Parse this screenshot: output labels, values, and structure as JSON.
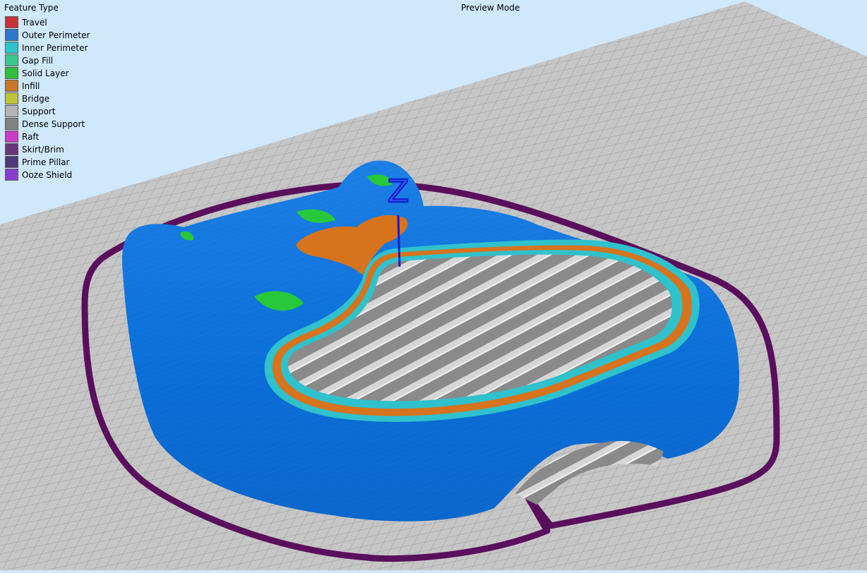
{
  "legend": {
    "title": "Feature Type",
    "items": [
      {
        "key": "travel",
        "label": "Travel",
        "color": "#c8333a"
      },
      {
        "key": "outer-perimeter",
        "label": "Outer Perimeter",
        "color": "#2e77c9"
      },
      {
        "key": "inner-perimeter",
        "label": "Inner Perimeter",
        "color": "#2fc1cc"
      },
      {
        "key": "gap-fill",
        "label": "Gap Fill",
        "color": "#3cc88c"
      },
      {
        "key": "solid-layer",
        "label": "Solid Layer",
        "color": "#2fbf3b"
      },
      {
        "key": "infill",
        "label": "Infill",
        "color": "#c8782c"
      },
      {
        "key": "bridge",
        "label": "Bridge",
        "color": "#c0c43a"
      },
      {
        "key": "support",
        "label": "Support",
        "color": "#b4b4b4"
      },
      {
        "key": "dense-support",
        "label": "Dense Support",
        "color": "#828282"
      },
      {
        "key": "raft",
        "label": "Raft",
        "color": "#c93cc8"
      },
      {
        "key": "skirt-brim",
        "label": "Skirt/Brim",
        "color": "#6b3579"
      },
      {
        "key": "prime-pillar",
        "label": "Prime Pillar",
        "color": "#4d3a7a"
      },
      {
        "key": "ooze-shield",
        "label": "Ooze Shield",
        "color": "#8a3ccf"
      }
    ]
  },
  "view": {
    "mode_label": "Preview Mode",
    "axis_label": "Z"
  },
  "scene": {
    "background_color": "#cfe8fb",
    "bed_color": "#c6c6c6",
    "grid_color": "#8f8f8f",
    "model_color": "#0a6fd8",
    "skirt_color": "#5a0f5c",
    "support_color": "#b9b9b9",
    "infill_color": "#d7731c",
    "solid_color": "#27c83a",
    "axis_color": "#1a1ad6"
  }
}
